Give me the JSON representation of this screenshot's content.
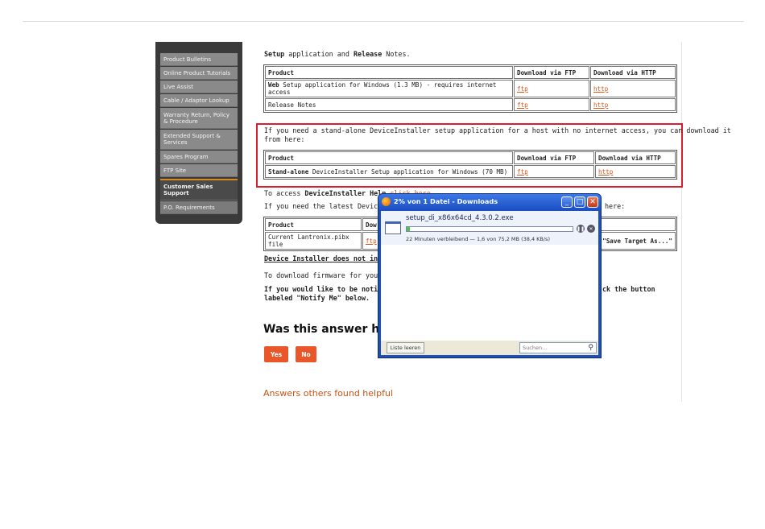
{
  "sidebar": {
    "items": [
      {
        "label": "Product Bulletins"
      },
      {
        "label": "Online Product Tutorials"
      },
      {
        "label": "Live Assist"
      },
      {
        "label": "Cable / Adaptor Lookup"
      },
      {
        "label": "Warranty Return, Policy & Procedure"
      },
      {
        "label": "Extended Support & Services"
      },
      {
        "label": "Spares Program"
      },
      {
        "label": "FTP Site"
      },
      {
        "label": "Customer Sales Support"
      },
      {
        "label": "P.O. Requirements"
      }
    ]
  },
  "main": {
    "intro_bold1": "Setup",
    "intro_mid": " application and ",
    "intro_bold2": "Release",
    "intro_end": " Notes.",
    "table1": {
      "headers": [
        "Product",
        "Download via FTP",
        "Download via HTTP"
      ],
      "rows": [
        {
          "bold": "Web",
          "rest": " Setup application for Windows (1.3 MB) - requires internet access",
          "ftp": "ftp",
          "http": "http"
        },
        {
          "bold": "",
          "rest": "Release Notes",
          "ftp": "ftp",
          "http": "http"
        }
      ]
    },
    "standalone_text1": "If you need a stand-alone DeviceInstaller setup application for a host with no internet access, you can download it",
    "standalone_text2": "from here:",
    "table2": {
      "headers": [
        "Product",
        "Download via FTP",
        "Download via HTTP"
      ],
      "row": {
        "bold": "Stand-alone",
        "rest": " DeviceInstaller Setup application for Windows (70 MB)",
        "ftp": "ftp",
        "http": "http"
      }
    },
    "help_pre": "To access ",
    "help_bold": "DeviceInstaller Help",
    "help_link": "click here",
    "latest_pre": "If you need the latest DeviceIns",
    "latest_post": "here:",
    "table3": {
      "header_product": "Product",
      "header_dl": "Dow",
      "row_product": "Current Lantronix.pibx file",
      "row_ftp": "ftp",
      "row_save": "\"Save Target As...\""
    },
    "not_include": "Device Installer does not inclu",
    "firmware": "To download firmware for your L",
    "notify1_pre": "If you would like to be notified",
    "notify1_post": "ck the button",
    "notify2": "labeled \"Notify Me\" below.",
    "heading": "Was this answer he",
    "yes_label": "Yes",
    "no_label": "No",
    "answers_heading": "Answers others found helpful"
  },
  "download_window": {
    "title": "2% von 1 Datei - Downloads",
    "filename": "setup_di_x86x64cd_4.3.0.2.exe",
    "progress": 0.02,
    "status": "22 Minuten verbleibend — 1,6 von 75,2 MB (38,4 KB/s)",
    "clear_label": "Liste leeren",
    "search_placeholder": "Suchen...",
    "pause_icon": "pause-icon",
    "cancel_icon": "cancel-icon"
  },
  "colors": {
    "accent": "#e8562a",
    "highlight_border": "#d6202f",
    "link": "#d0571b"
  }
}
